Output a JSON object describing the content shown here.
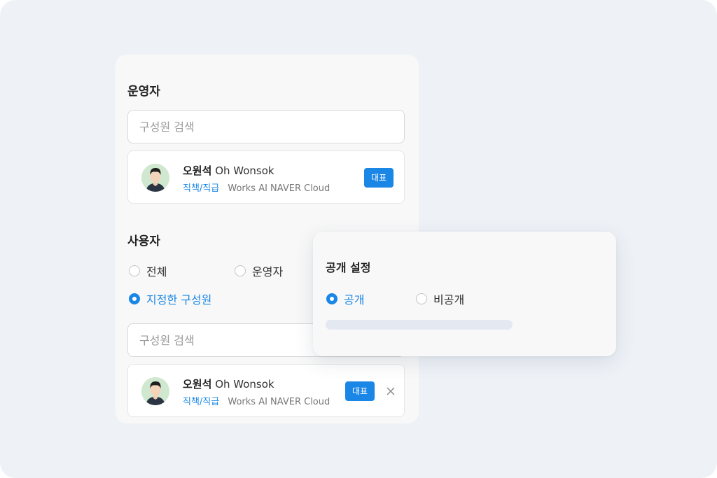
{
  "operators": {
    "title": "운영자",
    "search_placeholder": "구성원 검색",
    "member": {
      "name_ko": "오원석",
      "name_en": "Oh Wonsok",
      "role": "직책/직급",
      "org": "Works AI NAVER Cloud",
      "badge": "대표"
    }
  },
  "users": {
    "title": "사용자",
    "options": [
      {
        "label": "전체",
        "selected": false
      },
      {
        "label": "운영자",
        "selected": false
      },
      {
        "label": "지정한 구성원",
        "selected": true
      }
    ],
    "search_placeholder": "구성원 검색",
    "member": {
      "name_ko": "오원석",
      "name_en": "Oh Wonsok",
      "role": "직책/직급",
      "org": "Works AI NAVER Cloud",
      "badge": "대표",
      "remove_icon": "close-icon"
    }
  },
  "visibility": {
    "title": "공개 설정",
    "options": [
      {
        "label": "공개",
        "selected": true
      },
      {
        "label": "비공개",
        "selected": false
      }
    ]
  },
  "colors": {
    "accent": "#1a86e6",
    "background": "#eef2f7",
    "panel": "#f8f8f8",
    "avatar_bg": "#cfe8cf"
  }
}
